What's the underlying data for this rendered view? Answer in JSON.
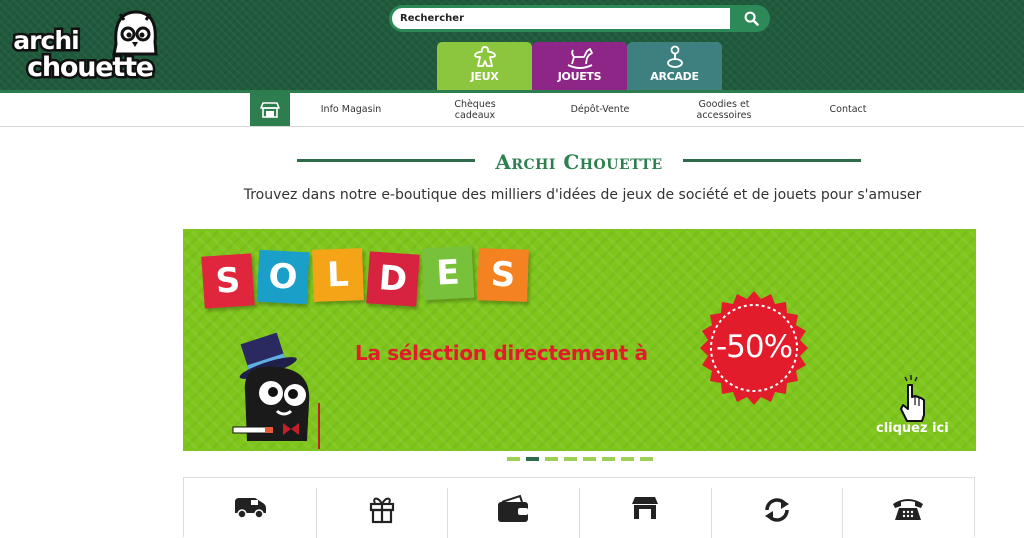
{
  "brand": {
    "logo_line1": "archi",
    "logo_line2": "chouette"
  },
  "search": {
    "placeholder": "Rechercher"
  },
  "categories": [
    {
      "label": "JEUX",
      "color": "#8cc63f",
      "icon": "meeple-icon"
    },
    {
      "label": "JOUETS",
      "color": "#8e2687",
      "icon": "rocking-horse-icon"
    },
    {
      "label": "ARCADE",
      "color": "#3e7f7f",
      "icon": "joystick-icon"
    }
  ],
  "nav": {
    "home_icon": "store-icon",
    "items": [
      {
        "label": "Info Magasin"
      },
      {
        "label": "Chèques cadeaux"
      },
      {
        "label": "Dépôt-Vente"
      },
      {
        "label": "Goodies et accessoires"
      },
      {
        "label": "Contact"
      }
    ]
  },
  "main": {
    "title": "Archi Chouette",
    "tagline": "Trouvez dans notre e-boutique des milliers d'idées de jeux de société et de jouets pour s'amuser"
  },
  "banner": {
    "letters": [
      "S",
      "O",
      "L",
      "D",
      "E",
      "S"
    ],
    "letter_colors": [
      "#e0263c",
      "#1aa0c8",
      "#f6a417",
      "#d72340",
      "#78c13b",
      "#f58220"
    ],
    "promo_text": "La sélection directement à",
    "discount": "-50%",
    "cta": "cliquez ici"
  },
  "carousel": {
    "slide_count": 8,
    "active_index": 1
  },
  "services": [
    {
      "icon": "delivery-truck-icon"
    },
    {
      "icon": "gift-icon"
    },
    {
      "icon": "wallet-icon"
    },
    {
      "icon": "store-icon"
    },
    {
      "icon": "refresh-icon"
    },
    {
      "icon": "telephone-icon"
    }
  ],
  "colors": {
    "primary_green": "#2e7d4f",
    "header_bg": "#1f5a3c",
    "title_green": "#2e8050",
    "banner_green": "#7ec61c",
    "promo_red": "#e21c2a"
  }
}
